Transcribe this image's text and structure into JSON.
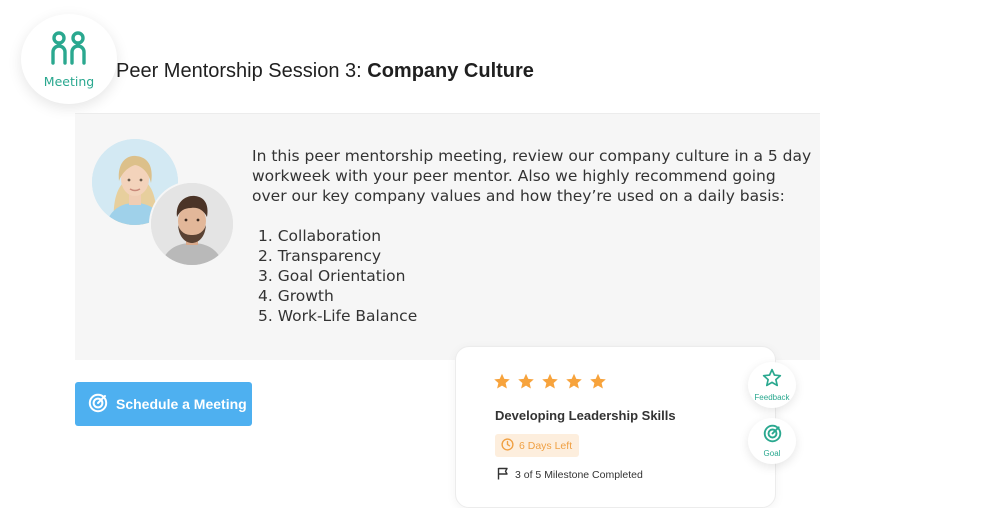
{
  "badge": {
    "label": "Meeting"
  },
  "header": {
    "title_prefix": "Peer Mentorship Session 3: ",
    "title_bold": "Company Culture"
  },
  "content": {
    "description": "In this peer mentorship meeting, review our company culture in a 5 day workweek with your peer mentor. Also we highly recommend going over our key company values and how they’re used on a daily basis:",
    "values": [
      "1. Collaboration",
      "2. Transparency",
      "3. Goal Orientation",
      "4. Growth",
      "5. Work-Life Balance"
    ]
  },
  "actions": {
    "schedule_label": "Schedule a Meeting"
  },
  "goal_card": {
    "rating": 5,
    "rating_max": 5,
    "title": "Developing Leadership Skills",
    "days_left": "6 Days Left",
    "milestone": "3 of 5 Milestone Completed"
  },
  "side_actions": {
    "feedback_label": "Feedback",
    "goal_label": "Goal"
  },
  "colors": {
    "accent_green": "#2aa88f",
    "button_blue": "#4eb0f0",
    "star_orange": "#f7a33c",
    "pill_bg": "#fdeedd"
  },
  "icons": [
    "meeting-icon",
    "target-icon",
    "star-icon",
    "clock-icon",
    "flag-icon",
    "star-outline-icon",
    "goal-icon"
  ]
}
